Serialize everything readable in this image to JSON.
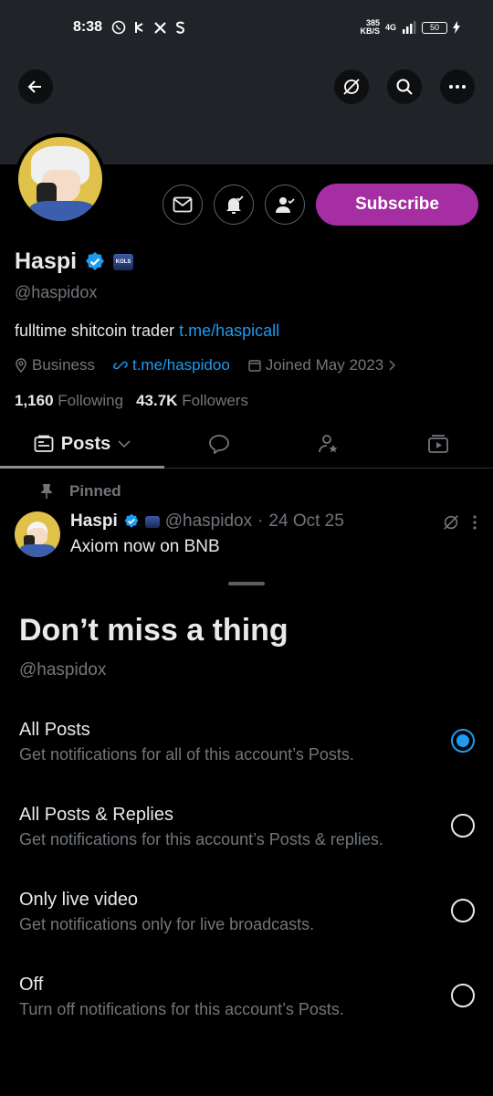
{
  "status_bar": {
    "time": "8:38",
    "speed_top": "385",
    "speed_bottom": "KB/S",
    "network": "4G",
    "battery": "50"
  },
  "profile": {
    "name": "Haspi",
    "handle": "@haspidox",
    "bio_text": "fulltime shitcoin trader ",
    "bio_link": "t.me/haspicall",
    "category": "Business",
    "website": "t.me/haspidoo",
    "joined": "Joined May 2023",
    "following_count": "1,160",
    "following_label": "Following",
    "followers_count": "43.7K",
    "followers_label": "Followers",
    "affiliate_badge": "KOLS",
    "subscribe_label": "Subscribe"
  },
  "tabs": {
    "posts_label": "Posts"
  },
  "pinned_tweet": {
    "pinned_label": "Pinned",
    "name": "Haspi",
    "handle": "@haspidox",
    "separator": "·",
    "date": "24 Oct 25",
    "text": "Axiom now on BNB"
  },
  "sheet": {
    "title": "Don’t miss a thing",
    "handle": "@haspidox",
    "options": [
      {
        "label": "All Posts",
        "desc": "Get notifications for all of this account’s Posts.",
        "selected": true
      },
      {
        "label": "All Posts & Replies",
        "desc": "Get notifications for this account’s Posts & replies.",
        "selected": false
      },
      {
        "label": "Only live video",
        "desc": "Get notifications only for live broadcasts.",
        "selected": false
      },
      {
        "label": "Off",
        "desc": "Turn off notifications for this account’s Posts.",
        "selected": false
      }
    ]
  },
  "colors": {
    "accent": "#1d9bf0",
    "subscribe": "#a62ea3",
    "muted": "#71767b"
  }
}
